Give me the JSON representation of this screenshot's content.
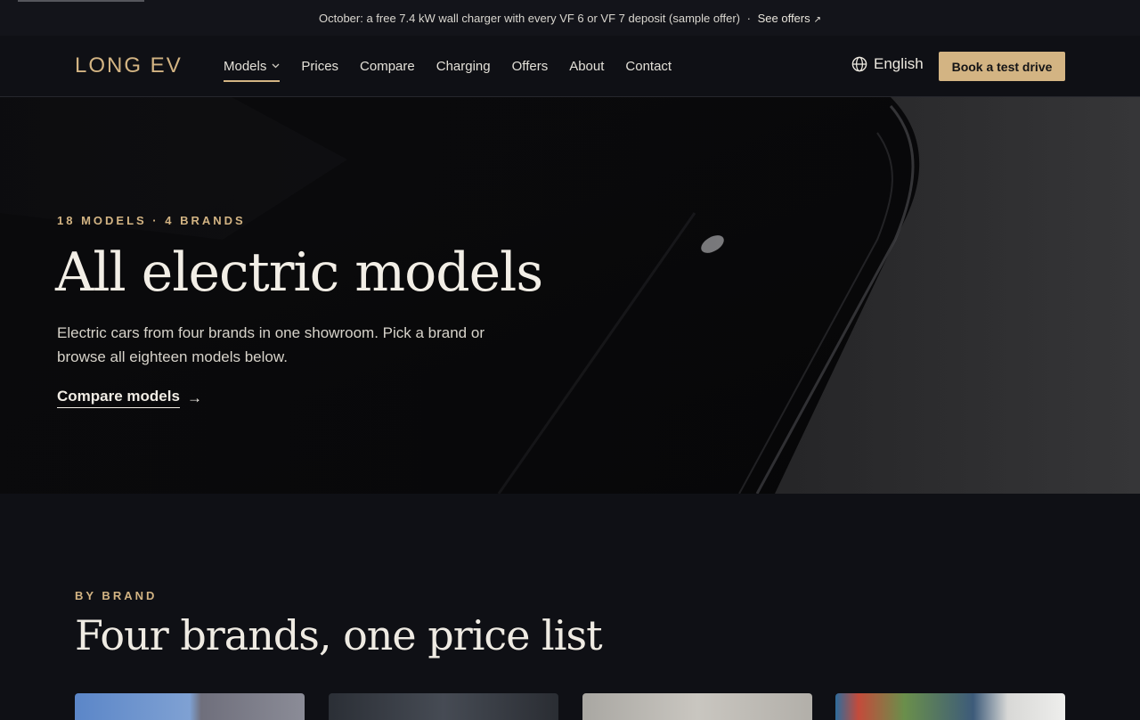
{
  "announcement": {
    "text": "October: a free 7.4 kW wall charger with every VF 6 or VF 7 deposit (sample offer)",
    "separator": "·",
    "link_label": "See offers",
    "link_arrow": "↗"
  },
  "header": {
    "logo": "LONG EV",
    "nav": [
      {
        "label": "Models",
        "has_dropdown": true,
        "active": true
      },
      {
        "label": "Prices"
      },
      {
        "label": "Compare"
      },
      {
        "label": "Charging"
      },
      {
        "label": "Offers"
      },
      {
        "label": "About"
      },
      {
        "label": "Contact"
      }
    ],
    "language": "English",
    "cta_label": "Book a test drive"
  },
  "hero": {
    "eyebrow": "18 MODELS · 4 BRANDS",
    "title": "All electric models",
    "description": "Electric cars from four brands in one showroom. Pick a brand or browse all eighteen models below.",
    "link_label": "Compare models",
    "link_arrow": "→"
  },
  "brands": {
    "eyebrow": "BY BRAND",
    "title": "Four brands, one price list"
  },
  "colors": {
    "accent": "#d3b483",
    "background": "#0f1015",
    "text": "#e9e5dc"
  }
}
